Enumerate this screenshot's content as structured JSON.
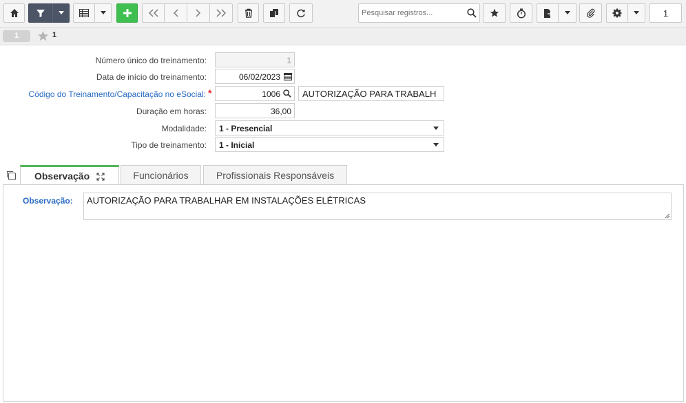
{
  "toolbar": {
    "buttons": [
      {
        "name": "home-button",
        "icon": "home-icon"
      },
      {
        "name": "filter-button",
        "icon": "filter-icon"
      },
      {
        "name": "grid-view-button",
        "icon": "grid-icon"
      },
      {
        "name": "add-button",
        "icon": "plus-icon"
      },
      {
        "name": "first-record-button",
        "icon": "double-chevron-left-icon"
      },
      {
        "name": "previous-record-button",
        "icon": "chevron-left-icon"
      },
      {
        "name": "next-record-button",
        "icon": "chevron-right-icon"
      },
      {
        "name": "last-record-button",
        "icon": "double-chevron-right-icon"
      },
      {
        "name": "delete-button",
        "icon": "trash-icon"
      },
      {
        "name": "duplicate-button",
        "icon": "copy-icon"
      },
      {
        "name": "refresh-button",
        "icon": "refresh-icon"
      },
      {
        "name": "favorite-button",
        "icon": "star-icon"
      },
      {
        "name": "timer-button",
        "icon": "stopwatch-icon"
      },
      {
        "name": "export-button",
        "icon": "file-export-icon"
      },
      {
        "name": "attach-button",
        "icon": "paperclip-icon"
      },
      {
        "name": "settings-button",
        "icon": "gear-icon"
      }
    ],
    "search_placeholder": "Pesquisar registros...",
    "page_number": "1",
    "colors": {
      "filter_bg": "#4b5566",
      "add_bg": "#3ebf4f"
    }
  },
  "record_strip": {
    "badge": "1",
    "record_number": "1"
  },
  "form": {
    "numero_unico": {
      "label": "Número único do treinamento:",
      "value": "1"
    },
    "data_inicio": {
      "label": "Data de início do treinamento:",
      "value": "06/02/2023"
    },
    "codigo_treinamento": {
      "label": "Código do Treinamento/Capacitação no eSocial:",
      "required_mark": "*",
      "value": "1006",
      "description": "AUTORIZAÇÃO PARA TRABALH"
    },
    "duracao": {
      "label": "Duração em horas:",
      "value": "36,00"
    },
    "modalidade": {
      "label": "Modalidade:",
      "value": "1 - Presencial"
    },
    "tipo": {
      "label": "Tipo de treinamento:",
      "value": "1 - Inicial"
    }
  },
  "tabs": [
    {
      "label": "Observação",
      "active": true
    },
    {
      "label": "Funcionários",
      "active": false
    },
    {
      "label": "Profissionais Responsáveis",
      "active": false
    }
  ],
  "observacao": {
    "label": "Observação:",
    "value": "AUTORIZAÇÃO PARA TRABALHAR EM INSTALAÇÕES ELÉTRICAS"
  },
  "colors": {
    "required_label": "#2a6cc4",
    "required_star": "#e02a2a",
    "active_tab_border": "#52b457"
  }
}
